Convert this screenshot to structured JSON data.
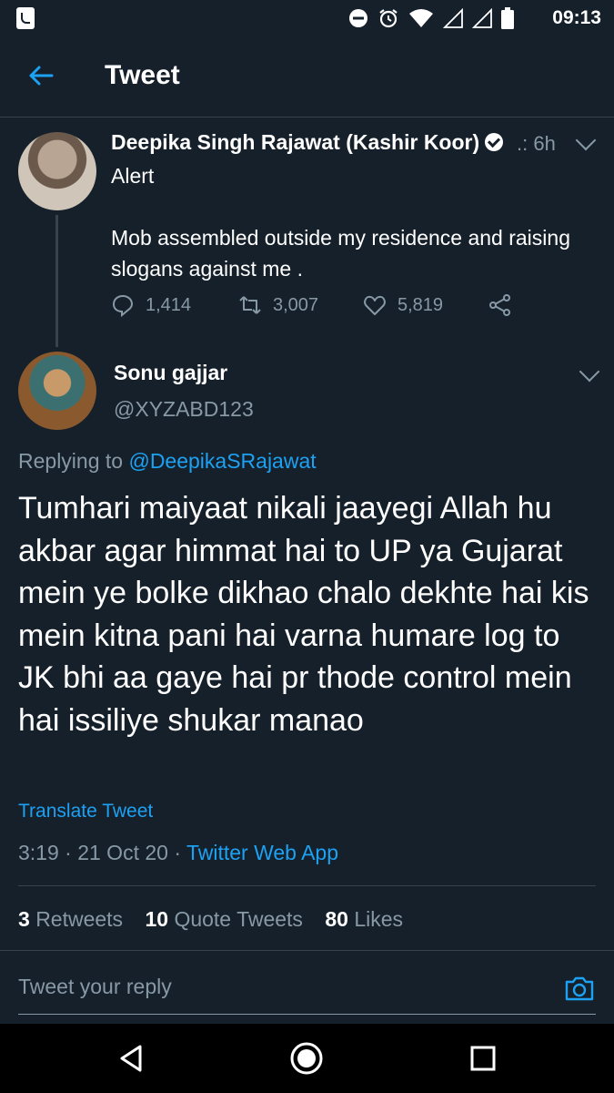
{
  "status_bar": {
    "time": "09:13",
    "icons": [
      "notification-icon",
      "do-not-disturb-icon",
      "alarm-icon",
      "wifi-icon",
      "signal-icon",
      "signal-icon",
      "battery-icon"
    ]
  },
  "header": {
    "title": "Tweet"
  },
  "parent_tweet": {
    "author_name": "Deepika Singh Rajawat (Kashir Koor)",
    "time": ".: 6h",
    "text": "Alert\n\nMob assembled outside my residence and raising slogans against me .",
    "replies": "1,414",
    "retweets": "3,007",
    "likes": "5,819"
  },
  "reply_tweet": {
    "author_name": "Sonu gajjar",
    "handle": "@XYZABD123",
    "replying_label": "Replying to",
    "replying_to": "@DeepikaSRajawat",
    "text": "Tumhari maiyaat nikali jaayegi Allah hu akbar agar himmat hai to UP ya Gujarat mein ye bolke dikhao chalo dekhte hai kis mein kitna pani hai varna humare log to JK bhi aa gaye hai pr thode control mein hai issiliye shukar manao",
    "translate_label": "Translate Tweet",
    "timestamp": "3:19 · 21 Oct 20 · ",
    "source": "Twitter Web App",
    "retweets_count": "3",
    "retweets_label": "Retweets",
    "quotes_count": "10",
    "quotes_label": "Quote Tweets",
    "likes_count": "80",
    "likes_label": "Likes"
  },
  "reply_box": {
    "placeholder": "Tweet your reply"
  },
  "colors": {
    "background": "#15202b",
    "accent": "#1da1f2",
    "secondary_text": "#8899a6",
    "divider": "#38444d"
  }
}
